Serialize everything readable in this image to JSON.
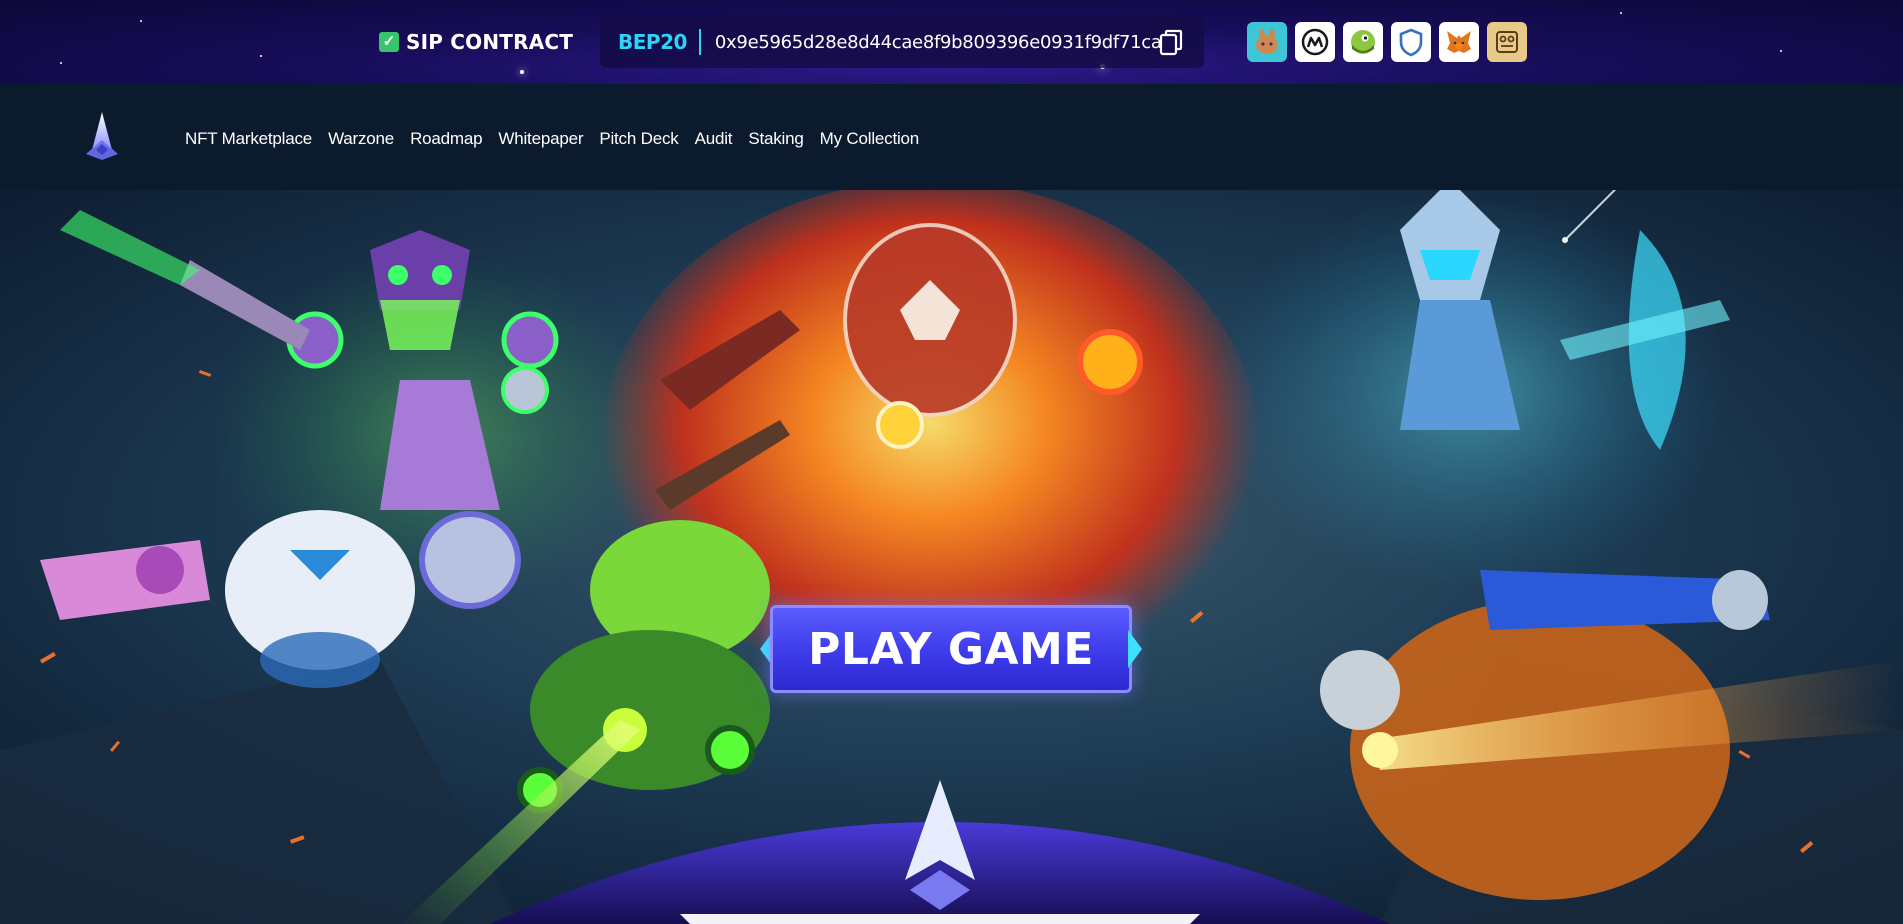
{
  "contract": {
    "label": "SIP CONTRACT",
    "network": "BEP20",
    "address": "0x9e5965d28e8d44cae8f9b809396e0931f9df71ca"
  },
  "exchange_badges": [
    "pancakeswap-icon",
    "coinmarketcap-icon",
    "coingecko-icon",
    "trustwallet-icon",
    "metamask-icon",
    "dappradar-icon"
  ],
  "nav": {
    "items": [
      {
        "label": "NFT Marketplace"
      },
      {
        "label": "Warzone"
      },
      {
        "label": "Roadmap"
      },
      {
        "label": "Whitepaper"
      },
      {
        "label": "Pitch Deck"
      },
      {
        "label": "Audit"
      },
      {
        "label": "Staking"
      },
      {
        "label": "My Collection"
      }
    ]
  },
  "hero": {
    "play_label": "PLAY GAME"
  },
  "colors": {
    "accent_cyan": "#2ed3f5",
    "button_blue": "#3b38e8",
    "check_green": "#39c46a",
    "topbar_bg": "#170d5a",
    "nav_bg": "#0c1a2e"
  }
}
